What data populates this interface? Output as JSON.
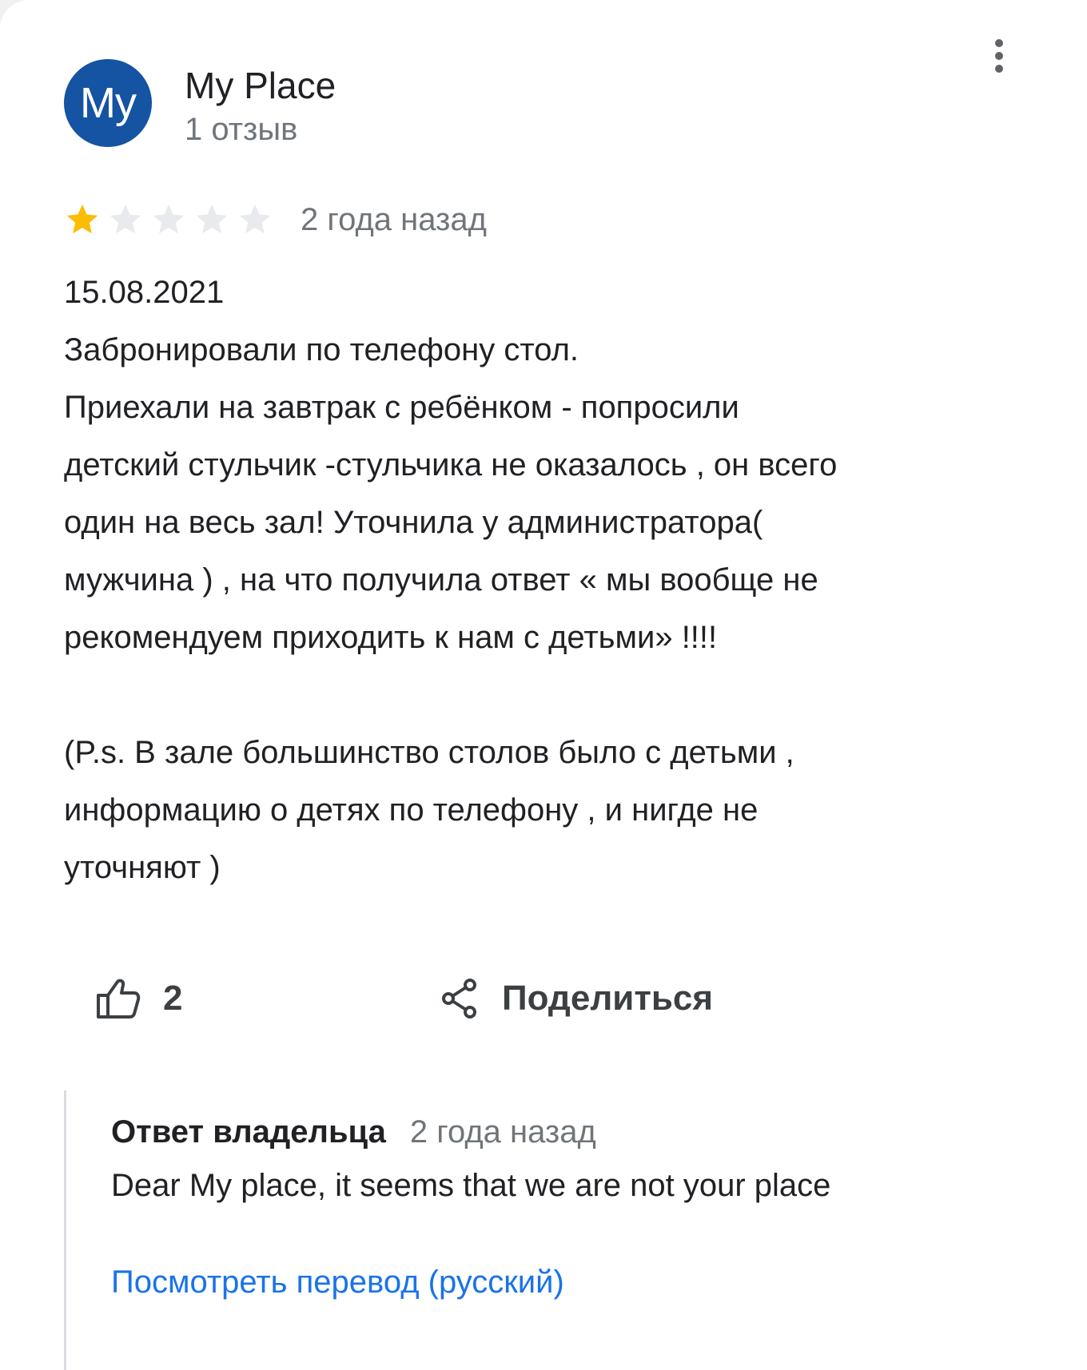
{
  "review": {
    "author": {
      "avatar_initials": "My",
      "avatar_color": "#1553a3",
      "name": "My Place",
      "review_count": "1 отзыв"
    },
    "more_icon": "more-vert-icon",
    "rating": {
      "stars": 1,
      "max_stars": 5,
      "filled_color": "#fbbc04",
      "empty_color": "#e8eaed"
    },
    "time_ago": "2 года назад",
    "text": "15.08.2021\nЗабронировали по телефону стол.\nПриехали на завтрак с ребёнком - попросили\nдетский стульчик -стульчика не оказалось , он всего\nодин на весь зал! Уточнила у администратора(\nмужчина ) , на что получила ответ « мы вообще не\nрекомендуем приходить к нам с детьми» !!!!\n\n(P.s. В зале большинство столов было с детьми ,\nинформацию о детях по телефону , и нигде не\nуточняют )",
    "actions": {
      "like_icon": "thumbs-up-icon",
      "like_count": "2",
      "share_icon": "share-icon",
      "share_label": "Поделиться"
    }
  },
  "owner_response": {
    "title": "Ответ владельца",
    "time_ago": "2 года назад",
    "text": "Dear My place, it seems that we are not your place",
    "translate_link": "Посмотреть перевод (русский)",
    "link_color": "#1a73e8"
  }
}
